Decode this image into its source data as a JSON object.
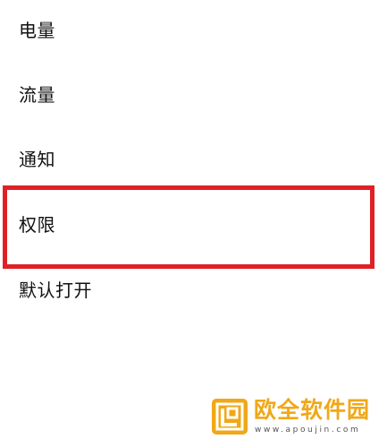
{
  "menu": {
    "items": [
      {
        "label": "电量"
      },
      {
        "label": "流量"
      },
      {
        "label": "通知"
      },
      {
        "label": "权限"
      },
      {
        "label": "默认打开"
      }
    ],
    "highlighted_item": "权限",
    "highlight_color": "#e02027"
  },
  "watermark": {
    "title": "欧全软件园",
    "url": "www.apoujin.com",
    "brand_color": "#f0a818",
    "logo_icon": "brand-logo-icon"
  }
}
